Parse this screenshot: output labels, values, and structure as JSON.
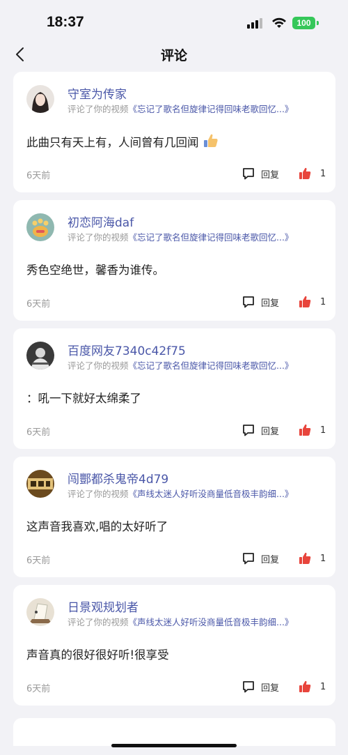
{
  "status": {
    "time": "18:37",
    "battery": "100"
  },
  "nav": {
    "title": "评论"
  },
  "comments": [
    {
      "user": "守室为传家",
      "action": "评论了你的视频",
      "video": "《忘记了歌名但旋律记得回味老歌回忆...》",
      "text": "此曲只有天上有，人间曾有几回闻",
      "emoji": "thumbs-up",
      "time": "6天前",
      "reply": "回复",
      "likes": "1"
    },
    {
      "user": "初恋阿海daf",
      "action": "评论了你的视频",
      "video": "《忘记了歌名但旋律记得回味老歌回忆...》",
      "text": "秀色空绝世，馨香为谁传。",
      "time": "6天前",
      "reply": "回复",
      "likes": "1"
    },
    {
      "user": "百度网友7340c42f75",
      "action": "评论了你的视频",
      "video": "《忘记了歌名但旋律记得回味老歌回忆...》",
      "text": "：吼一下就好太绵柔了",
      "time": "6天前",
      "reply": "回复",
      "likes": "1"
    },
    {
      "user": "闯酆都杀鬼帝4d79",
      "action": "评论了你的视频",
      "video": "《声线太迷人好听没商量低音极丰韵细...》",
      "text": "这声音我喜欢,唱的太好听了",
      "time": "6天前",
      "reply": "回复",
      "likes": "1"
    },
    {
      "user": "日景观规划者",
      "action": "评论了你的视频",
      "video": "《声线太迷人好听没商量低音极丰韵细...》",
      "text": "声音真的很好很好听!很享受",
      "time": "6天前",
      "reply": "回复",
      "likes": "1"
    }
  ],
  "colors": {
    "link": "#4a57a8",
    "like": "#e8453c",
    "background": "#f2f2f6"
  }
}
